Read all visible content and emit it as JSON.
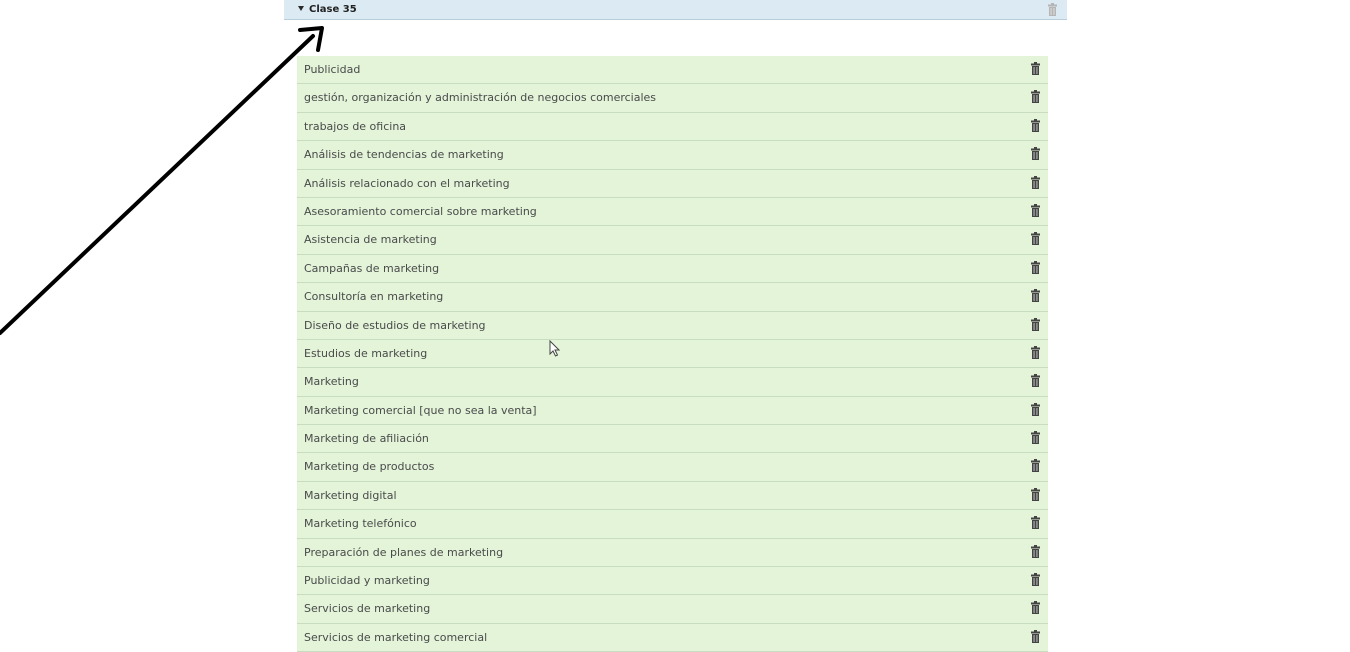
{
  "section": {
    "title": "Clase 35",
    "items": [
      {
        "label": "Publicidad"
      },
      {
        "label": "gestión, organización y administración de negocios comerciales"
      },
      {
        "label": "trabajos de oficina"
      },
      {
        "label": "Análisis de tendencias de marketing"
      },
      {
        "label": "Análisis relacionado con el marketing"
      },
      {
        "label": "Asesoramiento comercial sobre marketing"
      },
      {
        "label": "Asistencia de marketing"
      },
      {
        "label": "Campañas de marketing"
      },
      {
        "label": "Consultoría en marketing"
      },
      {
        "label": "Diseño de estudios de marketing"
      },
      {
        "label": "Estudios de marketing"
      },
      {
        "label": "Marketing"
      },
      {
        "label": "Marketing comercial [que no sea la venta]"
      },
      {
        "label": "Marketing de afiliación"
      },
      {
        "label": "Marketing de productos"
      },
      {
        "label": "Marketing digital"
      },
      {
        "label": "Marketing telefónico"
      },
      {
        "label": "Preparación de planes de marketing"
      },
      {
        "label": "Publicidad y marketing"
      },
      {
        "label": "Servicios de marketing"
      },
      {
        "label": "Servicios de marketing comercial"
      }
    ]
  },
  "icons": {
    "delete": "trash-icon",
    "expand": "caret-down-icon",
    "pointer": "mouse-cursor-icon",
    "annotation": "arrow-annotation"
  },
  "colors": {
    "header_bg": "#dbeaf3",
    "row_bg": "#e3f4d9",
    "text": "#4a4a4a",
    "icon": "#444444"
  }
}
